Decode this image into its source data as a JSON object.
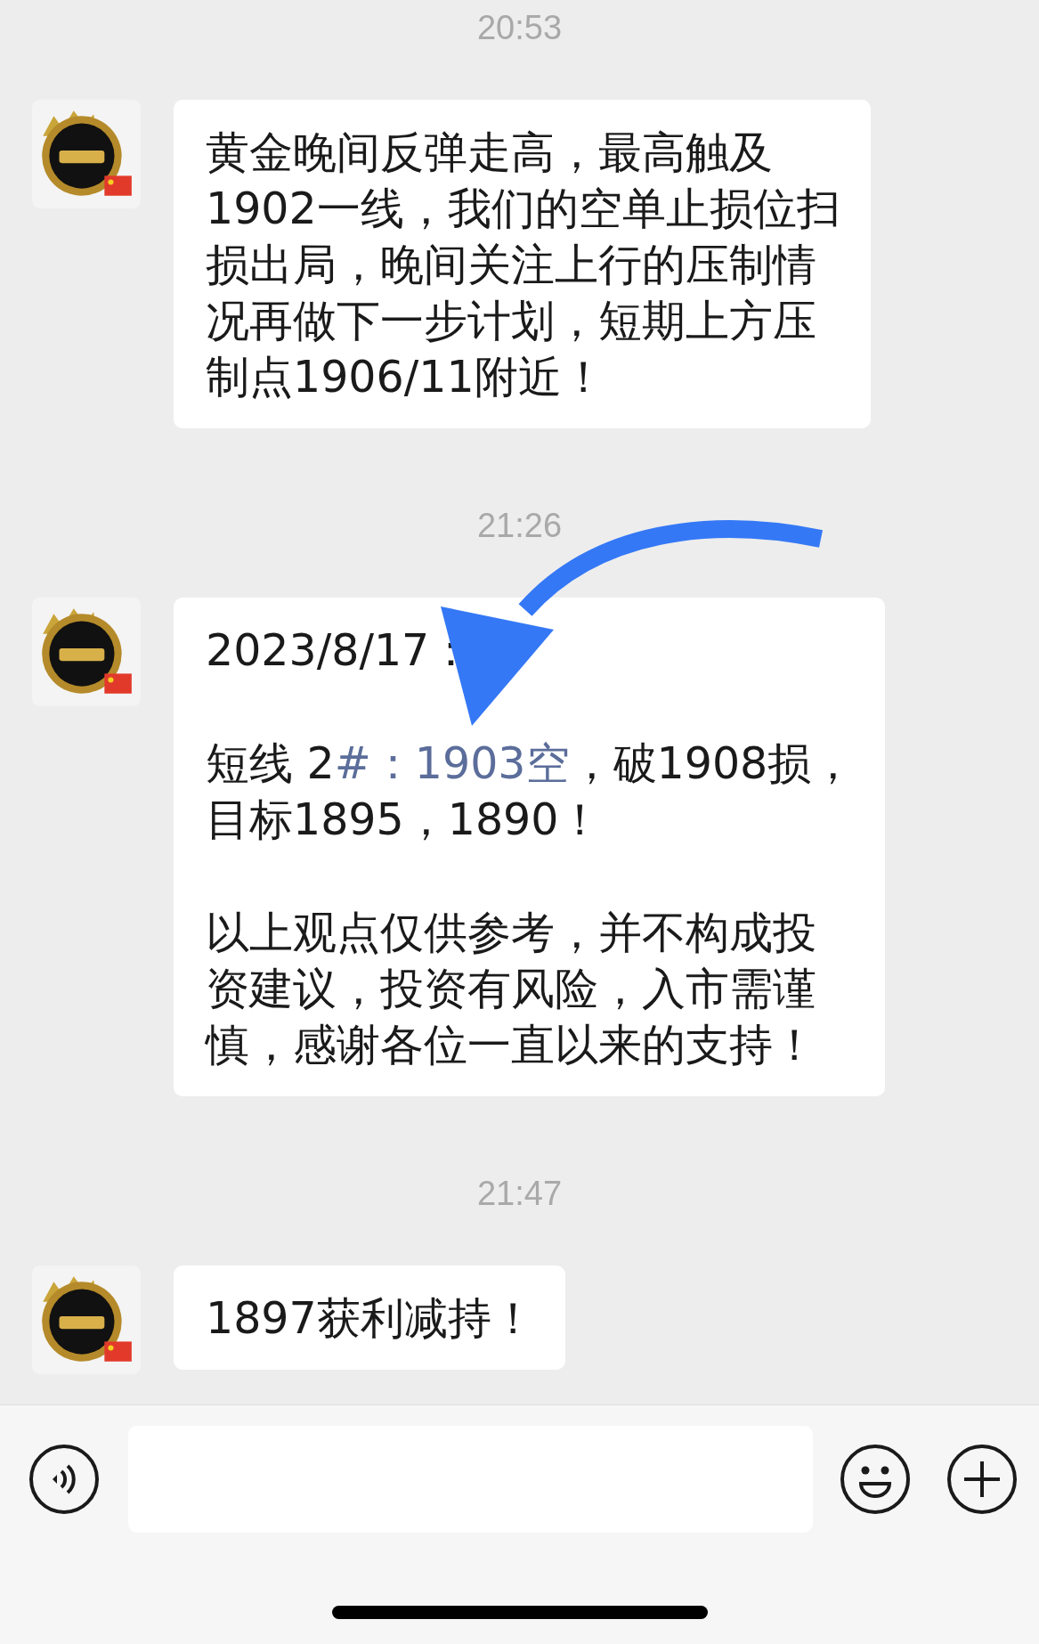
{
  "messages": [
    {
      "time": "20:53",
      "paragraphs": [
        {
          "lines": [
            [
              {
                "text": "黄金晚间反弹走高，最高触及"
              }
            ],
            [
              {
                "text": "1902一线，我们的空单止损位扫"
              }
            ],
            [
              {
                "text": "损出局，晚间关注上行的压制情"
              }
            ],
            [
              {
                "text": "况再做下一步计划，短期上方压"
              }
            ],
            [
              {
                "text": "制点1906/11附近！"
              }
            ]
          ]
        }
      ]
    },
    {
      "time": "21:26",
      "paragraphs": [
        {
          "lines": [
            [
              {
                "text": "2023/8/17："
              }
            ]
          ]
        },
        {
          "lines": [
            [
              {
                "text": "短线 2"
              },
              {
                "text": "#：1903空",
                "kind": "link"
              },
              {
                "text": "，破1908损，"
              }
            ],
            [
              {
                "text": "目标1895，1890！"
              }
            ]
          ]
        },
        {
          "lines": [
            [
              {
                "text": "以上观点仅供参考，并不构成投"
              }
            ],
            [
              {
                "text": "资建议，投资有风险，入市需谨"
              }
            ],
            [
              {
                "text": "慎，感谢各位一直以来的支持！"
              }
            ]
          ]
        }
      ]
    },
    {
      "time": "21:47",
      "paragraphs": [
        {
          "lines": [
            [
              {
                "text": "1897获利减持！"
              }
            ]
          ]
        }
      ]
    }
  ]
}
